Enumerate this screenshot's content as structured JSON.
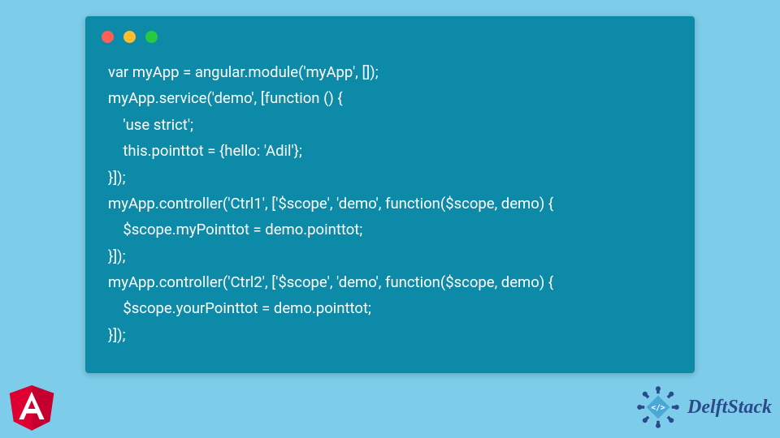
{
  "code": {
    "lines": [
      "var myApp = angular.module('myApp', []);",
      "myApp.service('demo', [function () {",
      "    'use strict';",
      "    this.pointtot = {hello: 'Adil'};",
      "}]);",
      "myApp.controller('Ctrl1', ['$scope', 'demo', function($scope, demo) {",
      "    $scope.myPointtot = demo.pointtot;",
      "}]);",
      "myApp.controller('Ctrl2', ['$scope', 'demo', function($scope, demo) {",
      "    $scope.yourPointtot = demo.pointtot;",
      "}]);"
    ]
  },
  "brands": {
    "angular": "Angular",
    "delftstack": "DelftStack"
  }
}
